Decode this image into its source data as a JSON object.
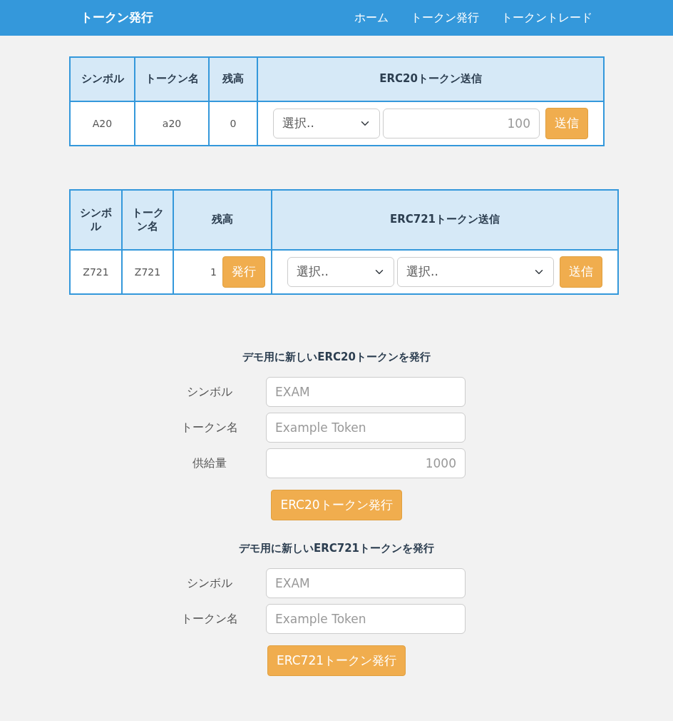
{
  "navbar": {
    "brand": "トークン発行",
    "links": [
      {
        "label": "ホーム"
      },
      {
        "label": "トークン発行"
      },
      {
        "label": "トークントレード"
      }
    ]
  },
  "erc20_table": {
    "columns": [
      "シンボル",
      "トークン名",
      "残高",
      "ERC20トークン送信"
    ],
    "rows": [
      {
        "symbol": "A20",
        "name": "a20",
        "balance": "0",
        "select": "選択..",
        "amount_placeholder": "100",
        "send_button": "送信"
      }
    ]
  },
  "erc721_table": {
    "columns": [
      "シンボル",
      "トークン名",
      "残高",
      "ERC721トークン送信"
    ],
    "rows": [
      {
        "symbol": "Z721",
        "name": "Z721",
        "balance": "1",
        "mint_button": "発行",
        "select_1": "選択..",
        "select_2": "選択..",
        "send_button": "送信"
      }
    ]
  },
  "forms": [
    {
      "title": "デモ用に新しいERC20トークンを発行",
      "fields": [
        {
          "label": "シンボル",
          "placeholder": "EXAM",
          "kind": "text"
        },
        {
          "label": "トークン名",
          "placeholder": "Example Token",
          "kind": "text"
        },
        {
          "label": "供給量",
          "placeholder": "1000",
          "kind": "number"
        }
      ],
      "button": "ERC20トークン発行"
    },
    {
      "title": "デモ用に新しいERC721トークンを発行",
      "fields": [
        {
          "label": "シンボル",
          "placeholder": "EXAM",
          "kind": "text"
        },
        {
          "label": "トークン名",
          "placeholder": "Example Token",
          "kind": "text"
        }
      ],
      "button": "ERC721トークン発行"
    }
  ]
}
